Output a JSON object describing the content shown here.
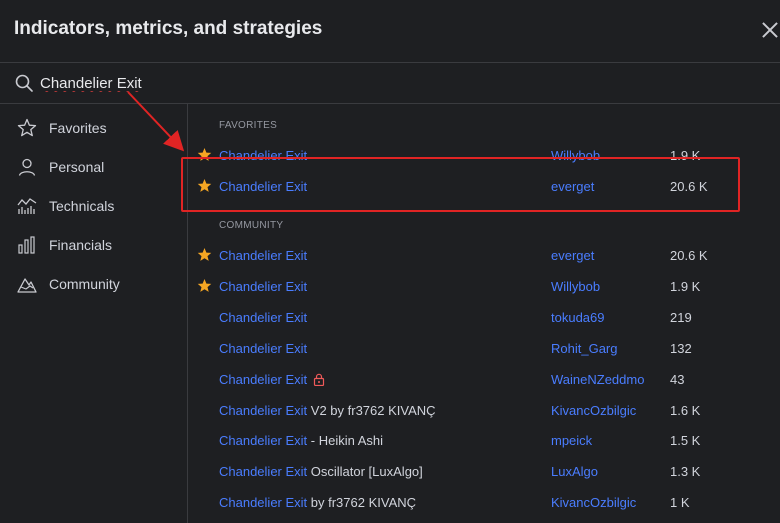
{
  "dialog": {
    "title": "Indicators, metrics, and strategies"
  },
  "search": {
    "value": "Chandelier Exit"
  },
  "sidebar": {
    "items": [
      {
        "label": "Favorites",
        "icon": "star-outline-icon"
      },
      {
        "label": "Personal",
        "icon": "person-icon"
      },
      {
        "label": "Technicals",
        "icon": "technicals-chart-icon"
      },
      {
        "label": "Financials",
        "icon": "bar-chart-icon"
      },
      {
        "label": "Community",
        "icon": "mountain-icon"
      }
    ]
  },
  "favorites": {
    "header": "FAVORITES",
    "rows": [
      {
        "name_highlight": "Chandelier Exit",
        "name_rest": "",
        "author": "Willybob",
        "count": "1.9 K",
        "starred": true
      },
      {
        "name_highlight": "Chandelier Exit",
        "name_rest": "",
        "author": "everget",
        "count": "20.6 K",
        "starred": true
      }
    ]
  },
  "community": {
    "header": "COMMUNITY",
    "rows": [
      {
        "name_highlight": "Chandelier Exit",
        "name_rest": "",
        "author": "everget",
        "count": "20.6 K",
        "starred": true,
        "locked": false
      },
      {
        "name_highlight": "Chandelier Exit",
        "name_rest": "",
        "author": "Willybob",
        "count": "1.9 K",
        "starred": true,
        "locked": false
      },
      {
        "name_highlight": "Chandelier Exit",
        "name_rest": "",
        "author": "tokuda69",
        "count": "219",
        "starred": false,
        "locked": false
      },
      {
        "name_highlight": "Chandelier Exit",
        "name_rest": "",
        "author": "Rohit_Garg",
        "count": "132",
        "starred": false,
        "locked": false
      },
      {
        "name_highlight": "Chandelier Exit",
        "name_rest": "",
        "author": "WaineNZeddmo",
        "count": "43",
        "starred": false,
        "locked": true
      },
      {
        "name_highlight": "Chandelier Exit",
        "name_rest": " V2 by fr3762 KIVANÇ",
        "author": "KivancOzbilgic",
        "count": "1.6 K",
        "starred": false,
        "locked": false
      },
      {
        "name_highlight": "Chandelier Exit",
        "name_rest": " - Heikin Ashi",
        "author": "mpeick",
        "count": "1.5 K",
        "starred": false,
        "locked": false
      },
      {
        "name_highlight": "Chandelier Exit",
        "name_rest": " Oscillator [LuxAlgo]",
        "author": "LuxAlgo",
        "count": "1.3 K",
        "starred": false,
        "locked": false
      },
      {
        "name_highlight": "Chandelier Exit",
        "name_rest": " by fr3762 KIVANÇ",
        "author": "KivancOzbilgic",
        "count": "1 K",
        "starred": false,
        "locked": false
      }
    ]
  },
  "colors": {
    "accent": "#4a7dff",
    "star": "#f5a623",
    "annotation": "#e02424",
    "lock": "#f05a5a"
  }
}
